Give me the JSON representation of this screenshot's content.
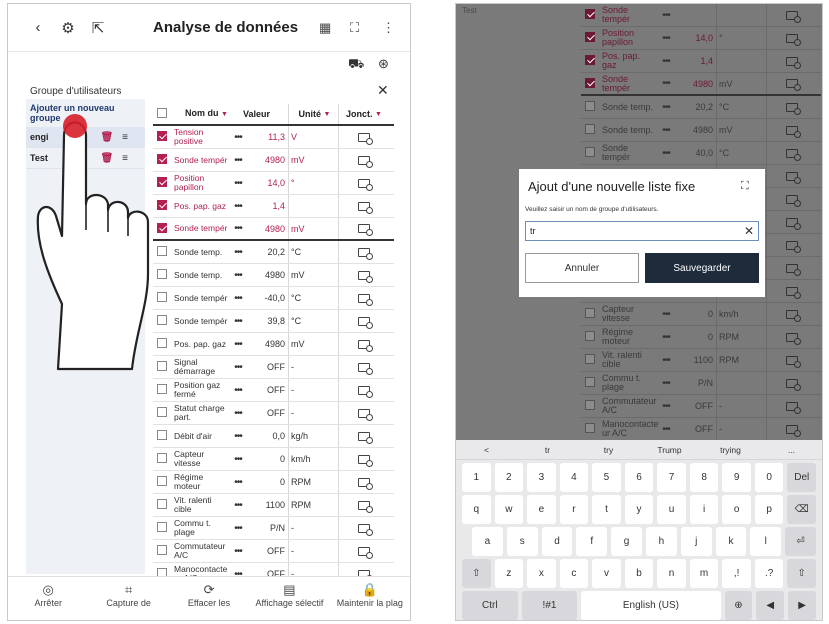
{
  "header": {
    "title": "Analyse de données",
    "icons": [
      "back-arrow-icon",
      "gear-scan-icon",
      "export-icon",
      "trend-icon",
      "expand-icon",
      "more-vert-icon",
      "tractor-icon",
      "settings-icon"
    ]
  },
  "groups": {
    "title": "Groupe d'utilisateurs",
    "add_label": "Ajouter un nouveau groupe",
    "items": [
      {
        "name": "engi"
      },
      {
        "name": "Test"
      }
    ]
  },
  "table": {
    "headers": {
      "name": "Nom du",
      "value": "Valeur",
      "unit": "Unité",
      "junction": "Jonct."
    },
    "rows": [
      {
        "name": "Tension positive",
        "value": "11,3",
        "unit": "V",
        "checked": true
      },
      {
        "name": "Sonde tempér",
        "value": "4980",
        "unit": "mV",
        "checked": true
      },
      {
        "name": "Position papillon",
        "value": "14,0",
        "unit": "°",
        "checked": true
      },
      {
        "name": "Pos. pap. gaz",
        "value": "1,4",
        "unit": "",
        "checked": true
      },
      {
        "name": "Sonde tempér",
        "value": "4980",
        "unit": "mV",
        "checked": true
      },
      {
        "name": "Sonde temp.",
        "value": "20,2",
        "unit": "°C",
        "checked": false
      },
      {
        "name": "Sonde temp.",
        "value": "4980",
        "unit": "mV",
        "checked": false
      },
      {
        "name": "Sonde tempér",
        "value": "-40,0",
        "unit": "°C",
        "checked": false
      },
      {
        "name": "Sonde tempér",
        "value": "39,8",
        "unit": "°C",
        "checked": false
      },
      {
        "name": "Pos. pap. gaz",
        "value": "4980",
        "unit": "mV",
        "checked": false
      },
      {
        "name": "Signal démarrage",
        "value": "OFF",
        "unit": "-",
        "checked": false
      },
      {
        "name": "Position gaz fermé",
        "value": "OFF",
        "unit": "-",
        "checked": false
      },
      {
        "name": "Statut charge part.",
        "value": "OFF",
        "unit": "-",
        "checked": false
      },
      {
        "name": "Débit d'air",
        "value": "0,0",
        "unit": "kg/h",
        "checked": false
      },
      {
        "name": "Capteur vitesse",
        "value": "0",
        "unit": "km/h",
        "checked": false
      },
      {
        "name": "Régime moteur",
        "value": "0",
        "unit": "RPM",
        "checked": false
      },
      {
        "name": "Vit. ralenti cible",
        "value": "1100",
        "unit": "RPM",
        "checked": false
      },
      {
        "name": "Commu t. plage",
        "value": "P/N",
        "unit": "-",
        "checked": false
      },
      {
        "name": "Commutateur A/C",
        "value": "OFF",
        "unit": "-",
        "checked": false
      },
      {
        "name": "Manocontacte ur A/C",
        "value": "OFF",
        "unit": "-",
        "checked": false
      }
    ]
  },
  "footer": {
    "buttons": [
      "Arrêter",
      "Capture de",
      "Effacer les",
      "Affichage sélectif",
      "Maintenir la plag"
    ]
  },
  "right_bg": {
    "top_text": "Test",
    "rows": [
      {
        "name": "Sonde tempér",
        "value": "",
        "unit": "",
        "checked": true
      },
      {
        "name": "Position papillon",
        "value": "14,0",
        "unit": "°",
        "checked": true
      },
      {
        "name": "Pos. pap. gaz",
        "value": "1,4",
        "unit": "",
        "checked": true
      },
      {
        "name": "Sonde tempér",
        "value": "4980",
        "unit": "mV",
        "checked": true
      },
      {
        "name": "Sonde temp.",
        "value": "20,2",
        "unit": "°C",
        "checked": false
      },
      {
        "name": "Sonde temp.",
        "value": "4980",
        "unit": "mV",
        "checked": false
      },
      {
        "name": "Sonde tempér",
        "value": "40,0",
        "unit": "°C",
        "checked": false
      },
      {
        "name": "",
        "value": "",
        "unit": "",
        "checked": false
      },
      {
        "name": "",
        "value": "",
        "unit": "",
        "checked": false
      },
      {
        "name": "",
        "value": "",
        "unit": "",
        "checked": false
      },
      {
        "name": "",
        "value": "",
        "unit": "",
        "checked": false
      },
      {
        "name": "",
        "value": "",
        "unit": "",
        "checked": false
      },
      {
        "name": "Débit d'air",
        "value": "0,0",
        "unit": "kg/h",
        "checked": false
      },
      {
        "name": "Capteur vitesse",
        "value": "0",
        "unit": "km/h",
        "checked": false
      },
      {
        "name": "Régime moteur",
        "value": "0",
        "unit": "RPM",
        "checked": false
      },
      {
        "name": "Vit. ralenti cible",
        "value": "1100",
        "unit": "RPM",
        "checked": false
      },
      {
        "name": "Commu t. plage",
        "value": "P/N",
        "unit": "",
        "checked": false
      },
      {
        "name": "Commutateur A/C",
        "value": "OFF",
        "unit": "-",
        "checked": false
      },
      {
        "name": "Manocontacte ur A/C",
        "value": "OFF",
        "unit": "-",
        "checked": false
      }
    ]
  },
  "dialog": {
    "title": "Ajout d'une nouvelle liste fixe",
    "hint": "Veuillez saisir un nom de groupe d'utilisateurs.",
    "input_value": "tr",
    "cancel_label": "Annuler",
    "save_label": "Sauvegarder"
  },
  "keyboard": {
    "suggestions": [
      "<",
      "tr",
      "try",
      "Trump",
      "trying",
      "..."
    ],
    "row1": [
      "1",
      "2",
      "3",
      "4",
      "5",
      "6",
      "7",
      "8",
      "9",
      "0",
      "Del"
    ],
    "row2": [
      "q",
      "w",
      "e",
      "r",
      "t",
      "y",
      "u",
      "i",
      "o",
      "p",
      "⌫"
    ],
    "row3": [
      "a",
      "s",
      "d",
      "f",
      "g",
      "h",
      "j",
      "k",
      "l",
      "⏎"
    ],
    "row4": [
      "⇧",
      "z",
      "x",
      "c",
      "v",
      "b",
      "n",
      "m",
      ",!",
      ".?",
      "⇧"
    ],
    "row5": [
      "Ctrl",
      "!#1",
      "English (US)",
      "⊕",
      "◀",
      "▶"
    ]
  }
}
